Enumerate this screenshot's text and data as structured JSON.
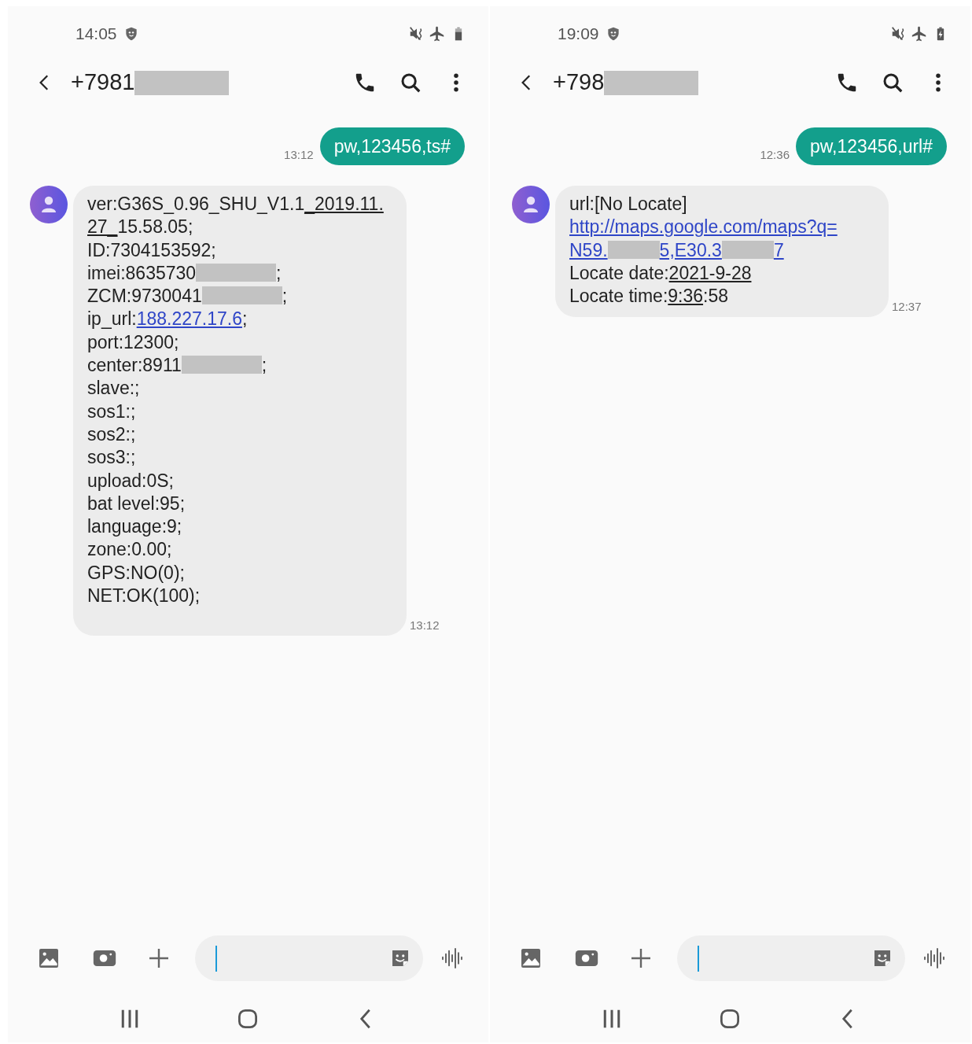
{
  "screens": [
    {
      "status_bar": {
        "time": "14:05",
        "battery_charging": false
      },
      "header": {
        "contact": [
          {
            "kind": "text",
            "text": "+7981"
          },
          {
            "kind": "redacted"
          }
        ]
      },
      "messages": [
        {
          "kind": "sent",
          "time": "13:12",
          "lines": [
            [
              {
                "kind": "text",
                "text": "pw,123456,ts#"
              }
            ]
          ]
        },
        {
          "kind": "received",
          "time": "13:12",
          "lines": [
            [
              {
                "kind": "text",
                "text": "ver:G36S_0.96_SHU_V1.1"
              },
              {
                "kind": "date_link",
                "text": "_2019.11."
              }
            ],
            [
              {
                "kind": "date_link",
                "text": "27_"
              },
              {
                "kind": "text",
                "text": "15.58.05;"
              }
            ],
            [
              {
                "kind": "text",
                "text": "ID:7304153592;"
              }
            ],
            [
              {
                "kind": "text",
                "text": "imei:8635730"
              },
              {
                "kind": "redacted"
              },
              {
                "kind": "text",
                "text": ";"
              }
            ],
            [
              {
                "kind": "text",
                "text": "ZCM:9730041"
              },
              {
                "kind": "redacted"
              },
              {
                "kind": "text",
                "text": ";"
              }
            ],
            [
              {
                "kind": "text",
                "text": "ip_url:"
              },
              {
                "kind": "link",
                "text": "188.227.17.6"
              },
              {
                "kind": "text",
                "text": ";"
              }
            ],
            [
              {
                "kind": "text",
                "text": "port:12300;"
              }
            ],
            [
              {
                "kind": "text",
                "text": "center:8911"
              },
              {
                "kind": "redacted"
              },
              {
                "kind": "text",
                "text": ";"
              }
            ],
            [
              {
                "kind": "text",
                "text": "slave:;"
              }
            ],
            [
              {
                "kind": "text",
                "text": "sos1:;"
              }
            ],
            [
              {
                "kind": "text",
                "text": "sos2:;"
              }
            ],
            [
              {
                "kind": "text",
                "text": "sos3:;"
              }
            ],
            [
              {
                "kind": "text",
                "text": "upload:0S;"
              }
            ],
            [
              {
                "kind": "text",
                "text": "bat level:95;"
              }
            ],
            [
              {
                "kind": "text",
                "text": "language:9;"
              }
            ],
            [
              {
                "kind": "text",
                "text": "zone:0.00;"
              }
            ],
            [
              {
                "kind": "text",
                "text": "GPS:NO(0);"
              }
            ],
            [
              {
                "kind": "text",
                "text": "NET:OK(100);"
              }
            ]
          ]
        }
      ]
    },
    {
      "status_bar": {
        "time": "19:09",
        "battery_charging": true
      },
      "header": {
        "contact": [
          {
            "kind": "text",
            "text": "+798"
          },
          {
            "kind": "redacted"
          }
        ]
      },
      "messages": [
        {
          "kind": "sent",
          "time": "12:36",
          "lines": [
            [
              {
                "kind": "text",
                "text": "pw,123456,url#"
              }
            ]
          ]
        },
        {
          "kind": "received",
          "time": "12:37",
          "lines": [
            [
              {
                "kind": "text",
                "text": "url:[No Locate]"
              }
            ],
            [
              {
                "kind": "link",
                "text": "http://maps.google.com/maps?q="
              }
            ],
            [
              {
                "kind": "link",
                "text": "N59."
              },
              {
                "kind": "redacted_short"
              },
              {
                "kind": "link",
                "text": "5,E30.3"
              },
              {
                "kind": "redacted_short"
              },
              {
                "kind": "link",
                "text": "7"
              }
            ],
            [
              {
                "kind": "text",
                "text": "Locate date:"
              },
              {
                "kind": "date_link",
                "text": "2021-9-28"
              }
            ],
            [
              {
                "kind": "text",
                "text": "Locate time:"
              },
              {
                "kind": "date_link",
                "text": "9:36"
              },
              {
                "kind": "text",
                "text": ":58"
              }
            ]
          ]
        }
      ]
    }
  ]
}
